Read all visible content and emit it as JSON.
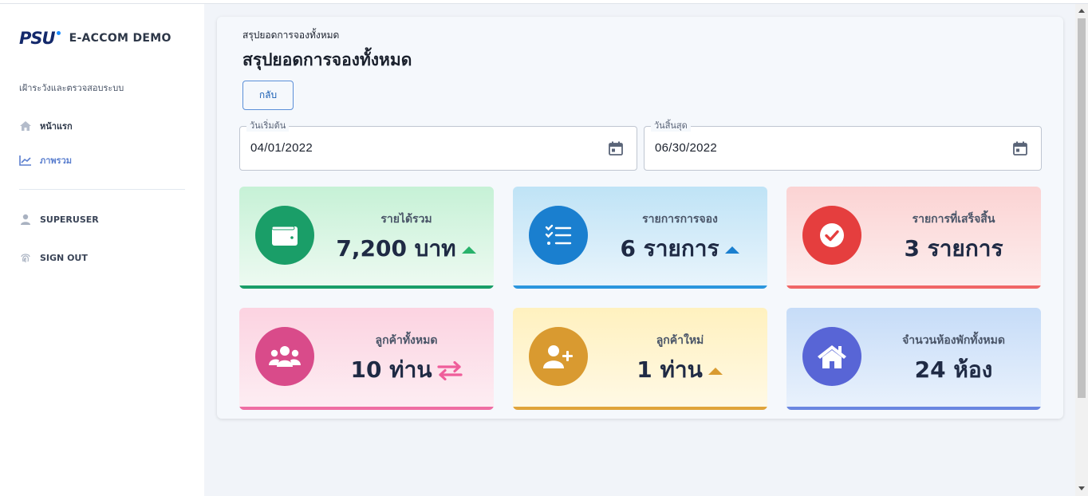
{
  "brand": {
    "logo_text": "PSU",
    "name": "E-ACCOM DEMO"
  },
  "sidebar": {
    "section_label": "เฝ้าระวังและตรวจสอบระบบ",
    "items": [
      {
        "label": "หน้าแรก",
        "icon": "home-icon"
      },
      {
        "label": "ภาพรวม",
        "icon": "chart-line-icon"
      }
    ],
    "user": {
      "label": "SUPERUSER",
      "icon": "user-icon"
    },
    "signout": {
      "label": "SIGN OUT",
      "icon": "fingerprint-icon"
    }
  },
  "header": {
    "breadcrumb": "สรุปยอดการจองทั้งหมด",
    "title": "สรุปยอดการจองทั้งหมด",
    "back_label": "กลับ"
  },
  "filters": {
    "start_label": "วันเริ่มต้น",
    "start_value": "04/01/2022",
    "end_label": "วันสิ้นสุด",
    "end_value": "06/30/2022"
  },
  "stats": [
    {
      "label": "รายได้รวม",
      "value": "7,200 บาท",
      "icon": "wallet-icon",
      "trend": "up",
      "color": "#1a9e68",
      "bar_color": "#1a9e68",
      "trend_color": "#28b26b"
    },
    {
      "label": "รายการการจอง",
      "value": "6 รายการ",
      "icon": "checklist-icon",
      "trend": "up",
      "color": "#1a7fcf",
      "bar_color": "#2b96de",
      "trend_color": "#1a7fcf"
    },
    {
      "label": "รายการที่เสร็จสิ้น",
      "value": "3 รายการ",
      "icon": "check-circle-icon",
      "trend": "none",
      "color": "#e53e3e",
      "bar_color": "#f06666",
      "trend_color": ""
    },
    {
      "label": "ลูกค้าทั้งหมด",
      "value": "10 ท่าน",
      "icon": "users-icon",
      "trend": "exchange",
      "color": "#d94b8a",
      "bar_color": "#ef6ea3",
      "trend_color": "#ef5d9a"
    },
    {
      "label": "ลูกค้าใหม่",
      "value": "1 ท่าน",
      "icon": "user-plus-icon",
      "trend": "up",
      "color": "#d99a30",
      "bar_color": "#e0a33a",
      "trend_color": "#d99a30"
    },
    {
      "label": "จำนวนห้องพักทั้งหมด",
      "value": "24 ห้อง",
      "icon": "house-icon",
      "trend": "none",
      "color": "#5865d6",
      "bar_color": "#6a86e0",
      "trend_color": ""
    }
  ]
}
